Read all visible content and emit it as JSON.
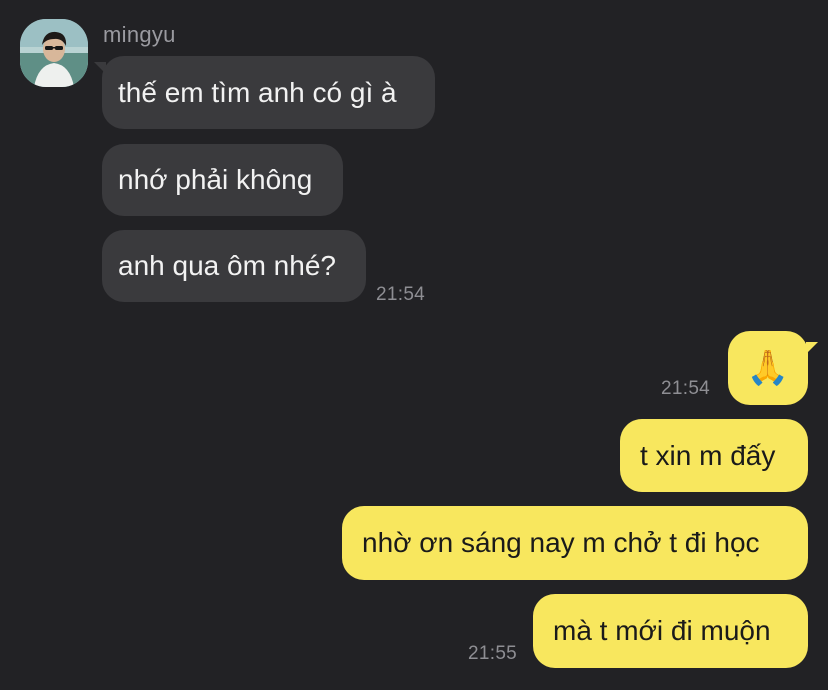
{
  "conversation": {
    "sender_name": "mingyu",
    "incoming": [
      {
        "text": "thế em tìm anh có gì à"
      },
      {
        "text": "nhớ phải không"
      },
      {
        "text": "anh qua ôm nhé?",
        "time": "21:54"
      }
    ],
    "outgoing": [
      {
        "emoji": "🙏",
        "emoji_name": "folded-hands-icon",
        "time": "21:54"
      },
      {
        "text": "t xin m đấy"
      },
      {
        "text": "nhờ ơn sáng nay m chở t đi học"
      },
      {
        "text": "mà t mới đi muộn",
        "time": "21:55"
      }
    ]
  },
  "colors": {
    "background": "#222225",
    "incoming_bubble": "#3a3a3d",
    "outgoing_bubble": "#f8e75e",
    "timestamp": "#8e8e93"
  }
}
